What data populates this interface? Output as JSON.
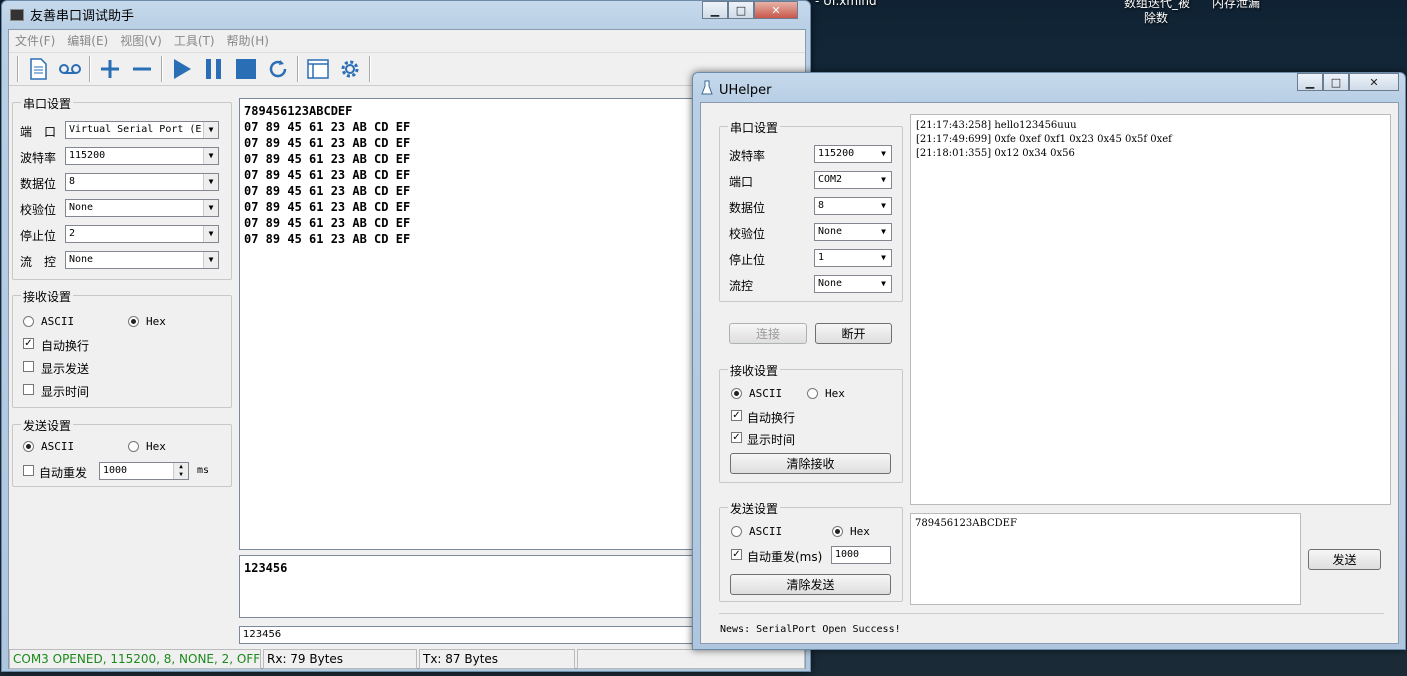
{
  "desktop": {
    "icon1": "- UI.xmind",
    "icon2_line1": "数组迭代_被",
    "icon2_line2": "除数",
    "icon3": "内存泄漏"
  },
  "win1": {
    "title": "友善串口调试助手",
    "menu": [
      "文件(F)",
      "编辑(E)",
      "视图(V)",
      "工具(T)",
      "帮助(H)"
    ],
    "toolbar_icons": [
      "new-file-icon",
      "record-icon",
      "plus-icon",
      "minus-icon",
      "play-icon",
      "pause-icon",
      "stop-icon",
      "refresh-icon",
      "window-icon",
      "gear-icon"
    ],
    "serial_group": "串口设置",
    "port_label": "端　口",
    "port_value": "Virtual Serial Port (E",
    "baud_label": "波特率",
    "baud_value": "115200",
    "databits_label": "数据位",
    "databits_value": "8",
    "parity_label": "校验位",
    "parity_value": "None",
    "stopbits_label": "停止位",
    "stopbits_value": "2",
    "flow_label": "流　控",
    "flow_value": "None",
    "recv_group": "接收设置",
    "recv_ascii": "ASCII",
    "recv_hex": "Hex",
    "auto_newline": "自动换行",
    "show_send": "显示发送",
    "show_time": "显示时间",
    "send_group": "发送设置",
    "send_ascii": "ASCII",
    "send_hex": "Hex",
    "auto_resend": "自动重发",
    "resend_interval": "1000",
    "ms": "ms",
    "recv_lines": [
      "789456123ABCDEF",
      "07 89 45 61 23 AB CD EF",
      "07 89 45 61 23 AB CD EF",
      "07 89 45 61 23 AB CD EF",
      "07 89 45 61 23 AB CD EF",
      "07 89 45 61 23 AB CD EF",
      "07 89 45 61 23 AB CD EF",
      "07 89 45 61 23 AB CD EF",
      "07 89 45 61 23 AB CD EF"
    ],
    "send_text": "123456",
    "history_text": "123456",
    "status_conn": "COM3 OPENED, 115200, 8, NONE, 2, OFF",
    "status_rx": "Rx: 79 Bytes",
    "status_tx": "Tx: 87 Bytes",
    "status_color": "#1a8a1a"
  },
  "win2": {
    "title": "UHelper",
    "serial_group": "串口设置",
    "baud_label": "波特率",
    "baud_value": "115200",
    "port_label": "端口",
    "port_value": "COM2",
    "databits_label": "数据位",
    "databits_value": "8",
    "parity_label": "校验位",
    "parity_value": "None",
    "stopbits_label": "停止位",
    "stopbits_value": "1",
    "flow_label": "流控",
    "flow_value": "None",
    "connect": "连接",
    "disconnect": "断开",
    "recv_group": "接收设置",
    "recv_ascii": "ASCII",
    "recv_hex": "Hex",
    "auto_newline": "自动换行",
    "show_time": "显示时间",
    "clear_recv": "清除接收",
    "send_group": "发送设置",
    "send_ascii": "ASCII",
    "send_hex": "Hex",
    "auto_resend": "自动重发(ms)",
    "resend_interval": "1000",
    "clear_send": "清除发送",
    "recv_lines": [
      "[21:17:43:258] hello123456uuu",
      "[21:17:49:699] 0xfe 0xef 0xf1 0x23 0x45 0x5f 0xef",
      "[21:18:01:355] 0x12 0x34 0x56"
    ],
    "send_text": "789456123ABCDEF",
    "send_button": "发送",
    "news": "News:  SerialPort Open Success!"
  }
}
